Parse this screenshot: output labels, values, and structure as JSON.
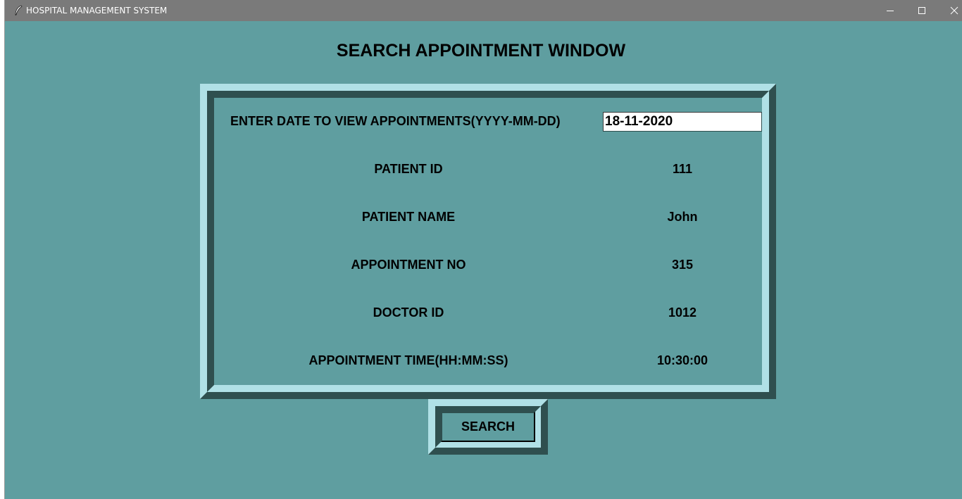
{
  "window": {
    "title": "HOSPITAL MANAGEMENT SYSTEM"
  },
  "page": {
    "heading": "SEARCH APPOINTMENT WINDOW"
  },
  "form": {
    "date_label": "ENTER DATE TO VIEW APPOINTMENTS(YYYY-MM-DD)",
    "date_value": "18-11-2020",
    "fields": [
      {
        "label": "PATIENT ID",
        "value": "111"
      },
      {
        "label": "PATIENT NAME",
        "value": "John"
      },
      {
        "label": "APPOINTMENT NO",
        "value": "315"
      },
      {
        "label": "DOCTOR ID",
        "value": "1012"
      },
      {
        "label": "APPOINTMENT TIME(HH:MM:SS)",
        "value": "10:30:00"
      }
    ]
  },
  "actions": {
    "search_label": "SEARCH"
  },
  "colors": {
    "background": "#5f9ea0",
    "frame_light": "#b0e0e6",
    "frame_dark": "#2f4f4f",
    "titlebar": "#7a7a7a"
  }
}
